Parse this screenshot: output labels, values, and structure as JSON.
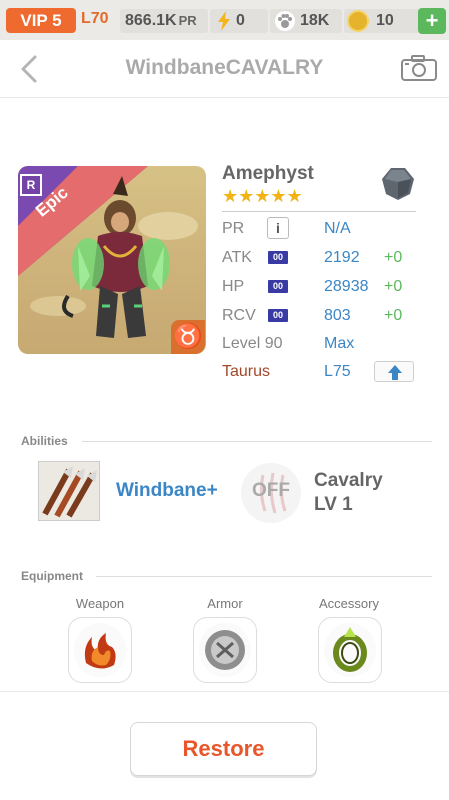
{
  "status_bar": {
    "vip": "VIP 5",
    "level": "L70",
    "pr_value": "866.1K",
    "pr_unit": "PR",
    "stamina": "0",
    "pets": "18K",
    "coins": "10",
    "add_label": "+"
  },
  "header": {
    "title": "WindbaneCAVALRY"
  },
  "hero": {
    "rarity_tag": "R",
    "rarity_ribbon": "Epic",
    "name": "Amephyst",
    "star_count": 5,
    "stars": "★★★★★",
    "zodiac_symbol": "♉",
    "stats": [
      {
        "label": "PR",
        "value": "N/A",
        "bonus": ""
      },
      {
        "label": "ATK",
        "chip": "00",
        "value": "2192",
        "bonus": "+0"
      },
      {
        "label": "HP",
        "chip": "00",
        "value": "28938",
        "bonus": "+0"
      },
      {
        "label": "RCV",
        "chip": "00",
        "value": "803",
        "bonus": "+0"
      },
      {
        "label": "Level 90",
        "value": "Max",
        "bonus": ""
      },
      {
        "label": "Taurus",
        "value": "L75",
        "bonus": ""
      }
    ],
    "info_icon": "i"
  },
  "abilities": {
    "title": "Abilities",
    "ability_name": "Windbane+",
    "toggle_label": "OFF",
    "class_name": "Cavalry",
    "class_level": "LV 1"
  },
  "equipment": {
    "title": "Equipment",
    "slots": [
      {
        "label": "Weapon",
        "icon": "fire-claw-icon"
      },
      {
        "label": "Armor",
        "icon": "silver-shield-icon"
      },
      {
        "label": "Accessory",
        "icon": "green-ring-icon"
      }
    ]
  },
  "footer": {
    "restore_label": "Restore"
  },
  "colors": {
    "accent_orange": "#ef6a2e",
    "link_blue": "#3b86c4",
    "bonus_green": "#5cb85c",
    "restore_red": "#e8562a",
    "star_gold": "#f2b316"
  }
}
